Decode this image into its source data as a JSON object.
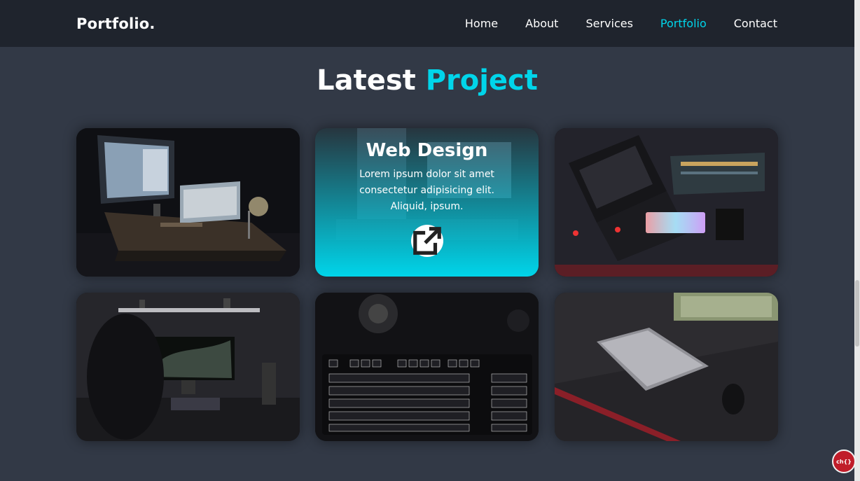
{
  "header": {
    "logo": "Portfolio.",
    "nav": [
      {
        "label": "Home",
        "active": false
      },
      {
        "label": "About",
        "active": false
      },
      {
        "label": "Services",
        "active": false
      },
      {
        "label": "Portfolio",
        "active": true
      },
      {
        "label": "Contact",
        "active": false
      }
    ]
  },
  "section": {
    "title_main": "Latest ",
    "title_accent": "Project"
  },
  "featured_card": {
    "title": "Web Design",
    "description": "Lorem ipsum dolor sit amet consectetur adipisicing elit. Aliquid, ipsum.",
    "link_icon": "external-link-icon"
  },
  "colors": {
    "accent": "#00d5ea",
    "background": "#323946",
    "header": "#1f242d"
  },
  "badge": {
    "label": "ch{}"
  }
}
